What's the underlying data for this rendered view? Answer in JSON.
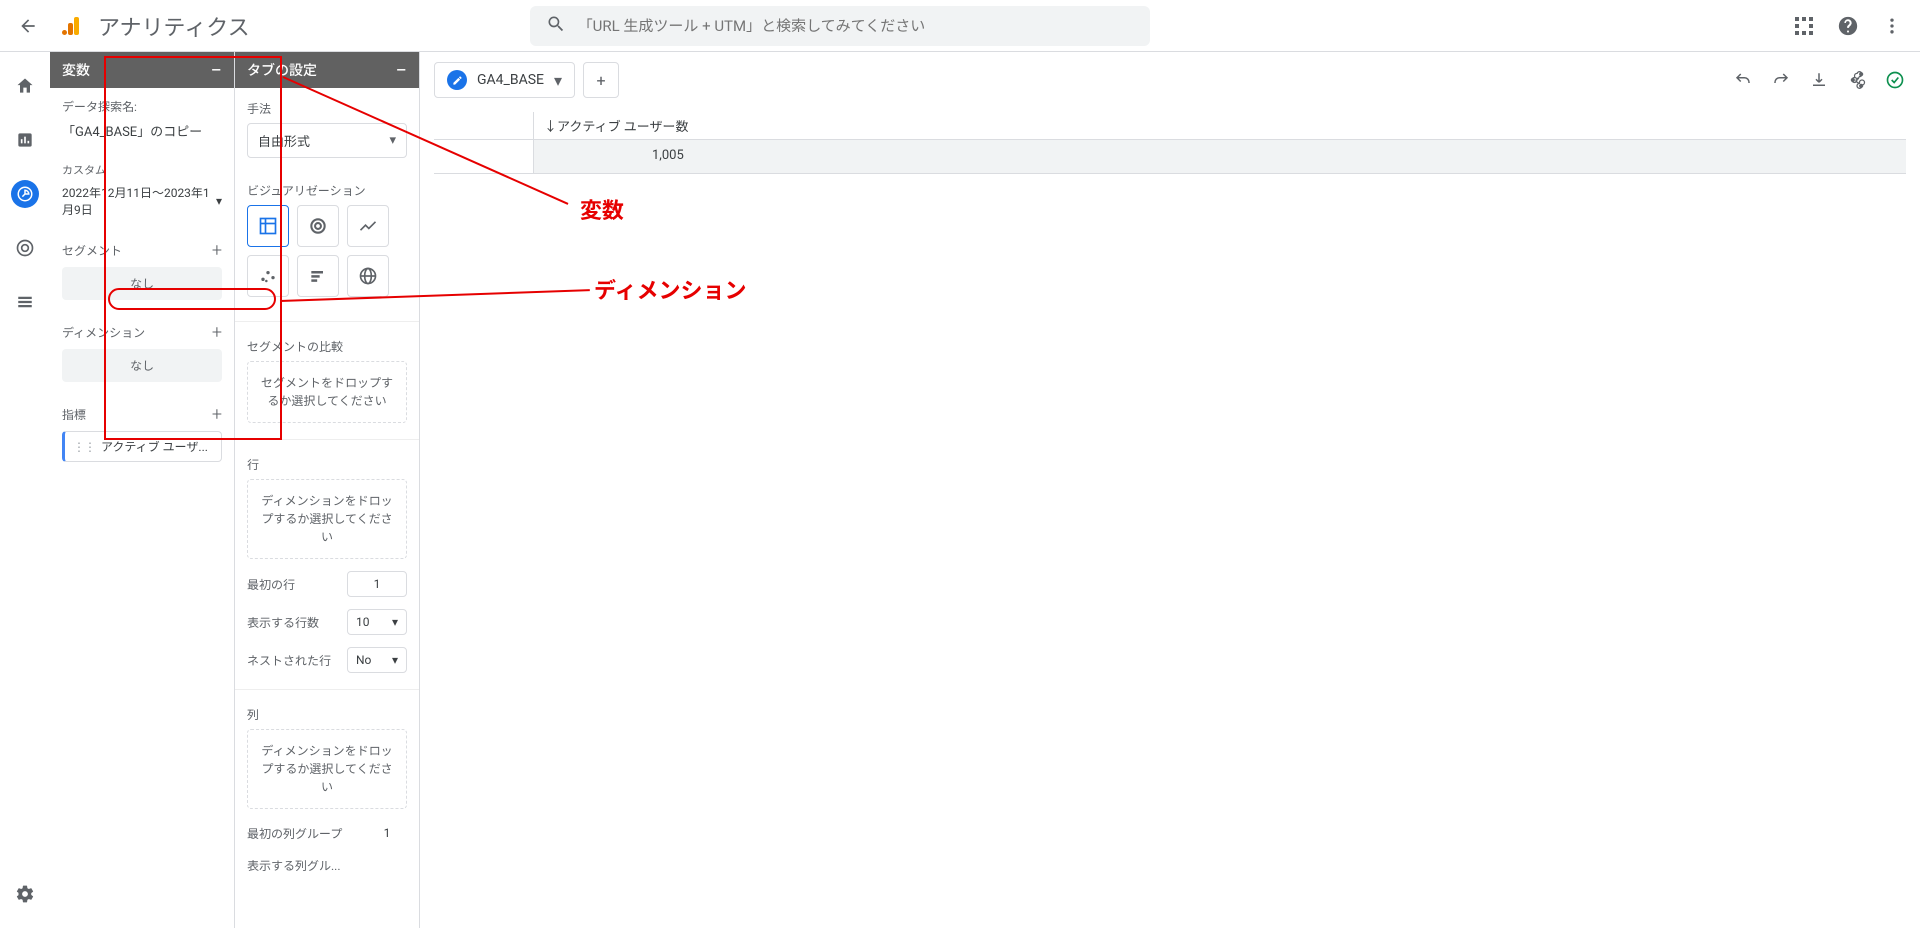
{
  "header": {
    "app_title": "アナリティクス",
    "search_placeholder": "「URL 生成ツール + UTM」と検索してみてください"
  },
  "variables_panel": {
    "title": "変数",
    "exploration_label": "データ探索名:",
    "exploration_name": "「GA4_BASE」のコピー",
    "custom_label": "カスタム",
    "date_range": "2022年12月11日～2023年1月9日",
    "segment_label": "セグメント",
    "none": "なし",
    "dimension_label": "ディメンション",
    "metric_label": "指標",
    "metric_chip": "アクティブ ユーザ..."
  },
  "tab_settings": {
    "title": "タブの設定",
    "technique_label": "手法",
    "technique_value": "自由形式",
    "viz_label": "ビジュアリゼーション",
    "seg_compare_label": "セグメントの比較",
    "seg_compare_drop": "セグメントをドロップするか選択してください",
    "rows_label": "行",
    "rows_drop": "ディメンションをドロップするか選択してください",
    "first_row_label": "最初の行",
    "first_row_value": "1",
    "show_rows_label": "表示する行数",
    "show_rows_value": "10",
    "nested_label": "ネストされた行",
    "nested_value": "No",
    "cols_label": "列",
    "cols_drop": "ディメンションをドロップするか選択してください",
    "first_col_group_label": "最初の列グループ",
    "first_col_group_value": "1",
    "show_col_groups_label": "表示する列グル..."
  },
  "canvas": {
    "tab_name": "GA4_BASE",
    "column_header": "↓アクティブ ユーザー数",
    "value": "1,005"
  },
  "annotations": {
    "label1": "変数",
    "label2": "ディメンション"
  }
}
